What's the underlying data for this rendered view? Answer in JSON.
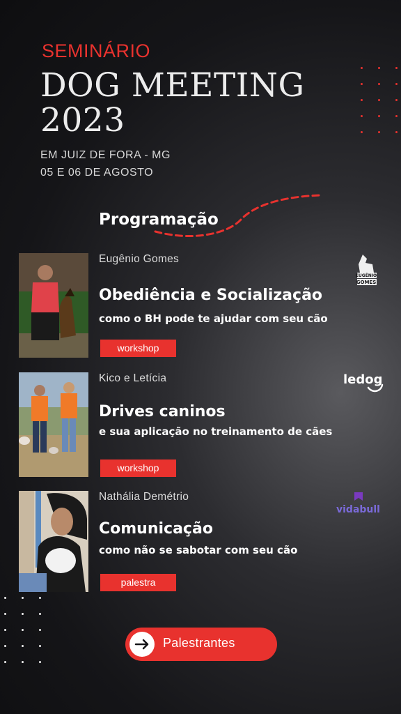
{
  "header": {
    "kicker": "SEMINÁRIO",
    "title_line1": "DOG MEETING",
    "title_line2": "2023",
    "location": "EM JUIZ DE FORA - MG",
    "dates": "05 E 06 DE AGOSTO"
  },
  "program": {
    "heading": "Programação",
    "events": [
      {
        "speaker": "Eugênio Gomes",
        "title": "Obediência e Socialização",
        "subtitle": "como o BH pode te ajudar com seu cão",
        "tag": "workshop",
        "logo_text_1": "EUGÊNIO",
        "logo_text_2": "GOMES"
      },
      {
        "speaker": "Kico e Letícia",
        "title": "Drives caninos",
        "subtitle": "e sua aplicação no treinamento de cães",
        "tag": "workshop",
        "logo_text": "ledog"
      },
      {
        "speaker": "Nathália Demétrio",
        "title": "Comunicação",
        "subtitle": "como não se sabotar com seu cão",
        "tag": "palestra",
        "logo_text": "vidabull"
      }
    ]
  },
  "cta": {
    "label": "Palestrantes",
    "icon": "arrow-right-icon"
  },
  "colors": {
    "accent": "#e8322e",
    "text": "#ffffff",
    "background": "#151518"
  }
}
